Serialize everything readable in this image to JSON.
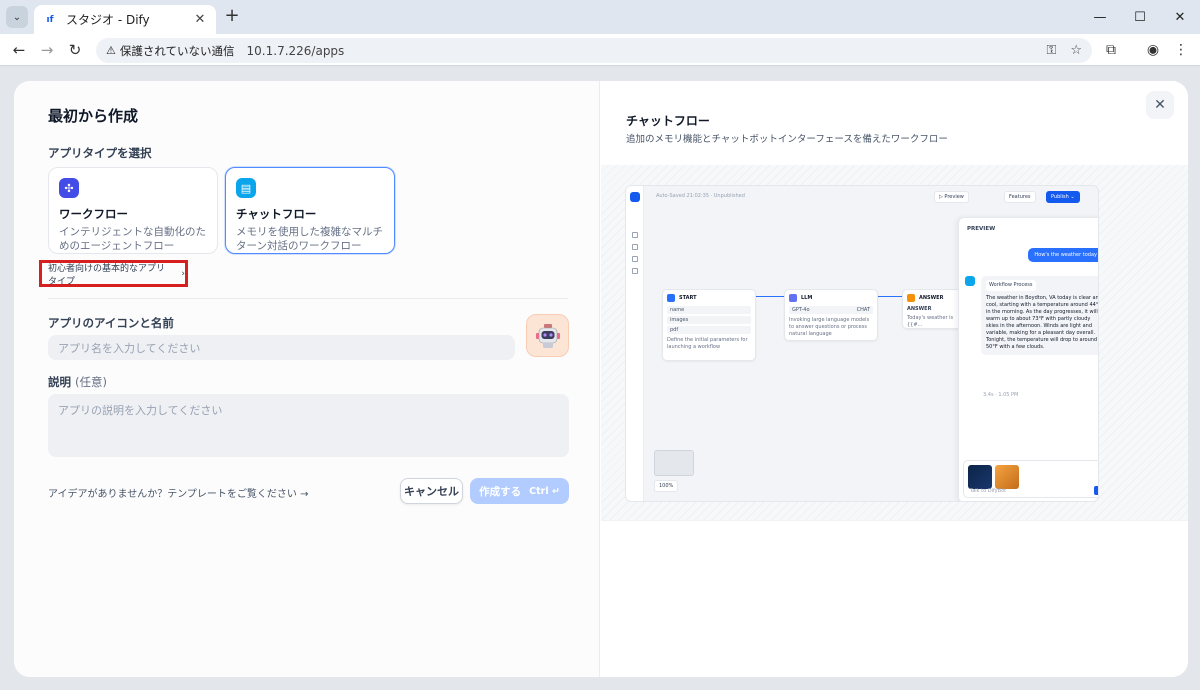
{
  "browser": {
    "tab_title": "スタジオ - Dify",
    "tab_favicon_text": "ıf",
    "security_label": "保護されていない通信",
    "url": "10.1.7.226/apps"
  },
  "dialog": {
    "title": "最初から作成",
    "app_type_label": "アプリタイプを選択",
    "types": [
      {
        "name": "ワークフロー",
        "desc": "インテリジェントな自動化のためのエージェントフロー",
        "color": "#444ce7"
      },
      {
        "name": "チャットフロー",
        "desc": "メモリを使用した複雑なマルチターン対話のワークフロー",
        "color": "#0ba5ec"
      }
    ],
    "basic_types_link": "初心者向けの基本的なアプリタイプ",
    "icon_name_label": "アプリのアイコンと名前",
    "name_placeholder": "アプリ名を入力してください",
    "description_label": "説明",
    "description_optional": "(任意)",
    "description_placeholder": "アプリの説明を入力してください",
    "template_link": "アイデアがありませんか？テンプレートをご覧ください →",
    "cancel_label": "キャンセル",
    "create_label": "作成する",
    "create_shortcut": "Ctrl ↵"
  },
  "preview": {
    "title": "チャットフロー",
    "description": "追加のメモリ機能とチャットボットインターフェースを備えたワークフロー",
    "shot": {
      "autosave": "Auto-Saved 21:02:35 · Unpublished",
      "toolbar_preview": "▷ Preview",
      "toolbar_features": "Features",
      "toolbar_publish": "Publish ⌄",
      "start_node": "START",
      "start_vars": [
        "name",
        "images",
        "pdf"
      ],
      "start_text": "Define the initial parameters for launching a workflow",
      "llm_node": "LLM",
      "llm_model": "GPT-4o",
      "llm_tag": "CHAT",
      "llm_text": "Invoking large language models to answer questions or process natural language",
      "answer_node": "ANSWER",
      "answer_label": "ANSWER",
      "answer_text": "Today's weather is {{#...",
      "panel_title": "PREVIEW",
      "user_message": "How's the weather today",
      "workflow_chip": "Workflow Process",
      "bot_message": "The weather in Boydton, VA today is clear and cool, starting with a temperature around 44°F in the morning. As the day progresses, it will warm up to about 73°F with partly cloudy skies in the afternoon. Winds are light and variable, making for a pleasant day overall. Tonight, the temperature will drop to around 50°F with a few clouds.",
      "bot_meta": "3.4s · 1.05 PM",
      "input_placeholder": "Talk to DifyBot",
      "zoom": "100%"
    }
  }
}
